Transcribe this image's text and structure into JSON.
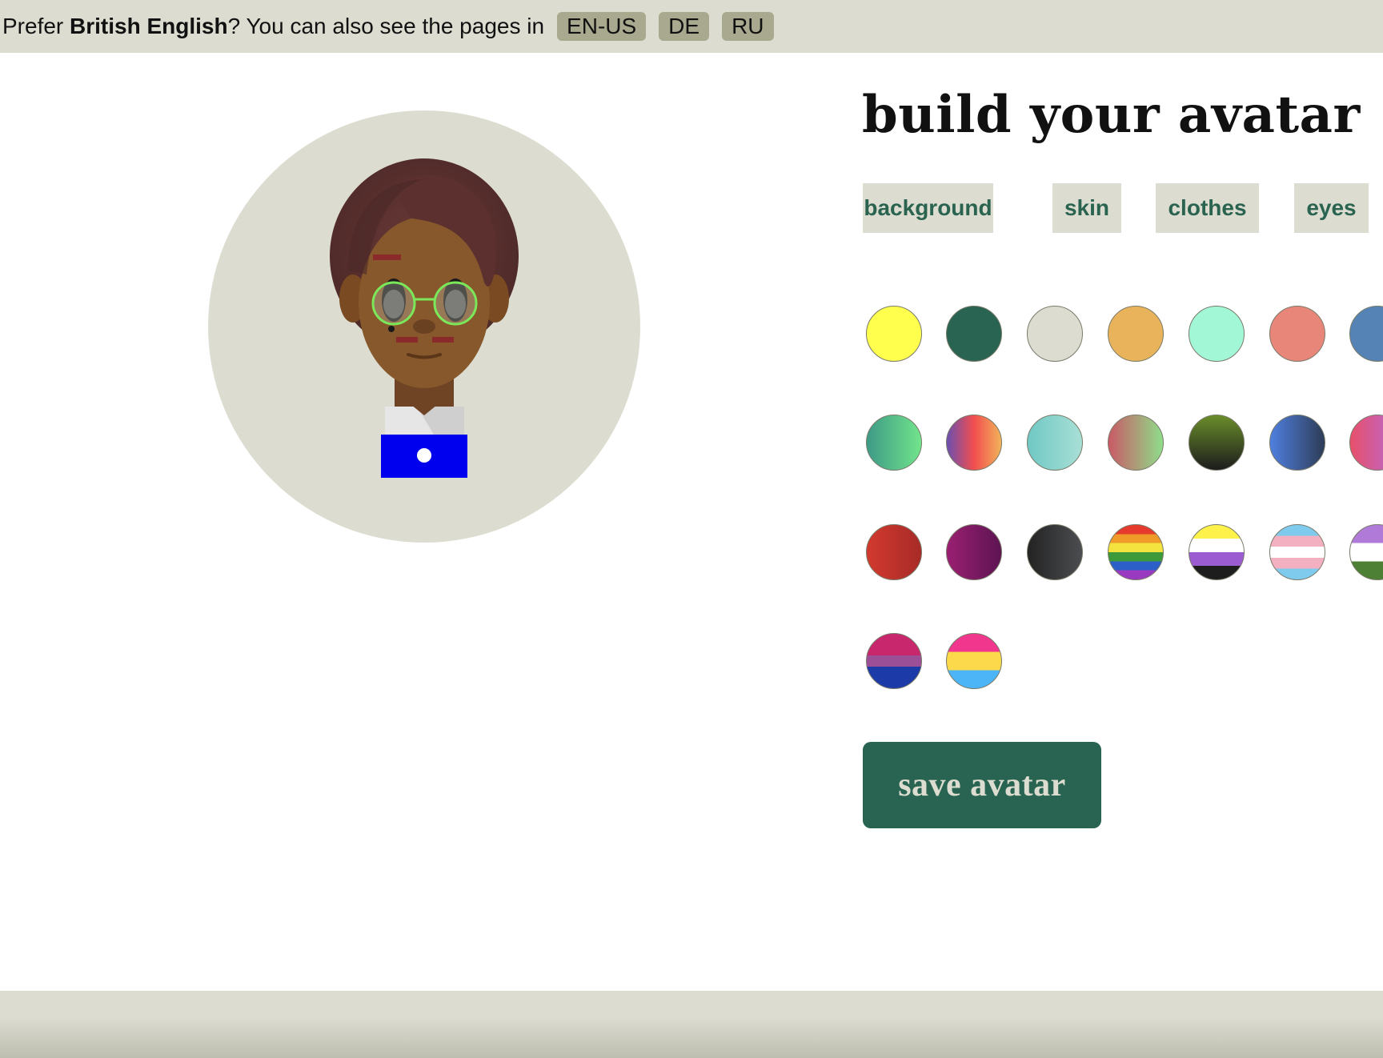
{
  "banner": {
    "prefix": "Prefer ",
    "language_name": "British English",
    "suffix": "? You can also see the pages in",
    "languages": [
      "EN-US",
      "DE",
      "RU"
    ]
  },
  "builder": {
    "title": "build your avatar",
    "tabs": [
      "background",
      "skin",
      "clothes",
      "eyes"
    ],
    "save_label": "save avatar"
  },
  "colors": {
    "banner_bg": "#dcddd0",
    "accent_green": "#296351",
    "tab_text": "#2a6350",
    "avatar_bg": "#dcddd0"
  },
  "background_swatches": [
    {
      "name": "yellow",
      "fill": "#ffff4d"
    },
    {
      "name": "dark-green",
      "fill": "#296351"
    },
    {
      "name": "light-gray",
      "fill": "#dcddd0"
    },
    {
      "name": "orange",
      "fill": "#e8b35a"
    },
    {
      "name": "mint",
      "fill": "#a2f7d6"
    },
    {
      "name": "salmon",
      "fill": "#e8867a"
    },
    {
      "name": "steel-blue",
      "fill": "#5583b5"
    },
    {
      "name": "teal-green-gradient",
      "fill": "linear-gradient(90deg,#3d9a86,#72e48c)"
    },
    {
      "name": "purple-red-orange-gradient",
      "fill": "linear-gradient(90deg,#6a4fb0,#f24e4e,#f2b35a)"
    },
    {
      "name": "aqua-gradient",
      "fill": "linear-gradient(90deg,#70c8c4,#a8dfd6)"
    },
    {
      "name": "red-green-gradient",
      "fill": "linear-gradient(90deg,#c95a66,#8fdd8a)"
    },
    {
      "name": "olive-black-gradient",
      "fill": "linear-gradient(180deg,#6a8d2a,#1c1c1c)"
    },
    {
      "name": "blue-navy-gradient",
      "fill": "linear-gradient(90deg,#4f7fe0,#2e3d57)"
    },
    {
      "name": "pink-purple-gradient",
      "fill": "linear-gradient(90deg,#e8506a,#b36be0)"
    },
    {
      "name": "red-gradient",
      "fill": "linear-gradient(90deg,#d23a2e,#a82a28)"
    },
    {
      "name": "magenta-gradient",
      "fill": "linear-gradient(90deg,#9a1f72,#5d1452)"
    },
    {
      "name": "charcoal-gradient",
      "fill": "linear-gradient(90deg,#232323,#4b4d50)"
    },
    {
      "name": "rainbow-flag",
      "fill": "linear-gradient(180deg,#e53a2c 0%,#e53a2c 16.6%,#f09a2a 16.6%,#f09a2a 33.3%,#f4e23e 33.3%,#f4e23e 50%,#3c9a3a 50%,#3c9a3a 66.6%,#2c5fc8 66.6%,#2c5fc8 83.3%,#9a3ac0 83.3%,#9a3ac0 100%)"
    },
    {
      "name": "nonbinary-flag",
      "fill": "linear-gradient(180deg,#fdf14a 0%,#fdf14a 25%,#ffffff 25%,#ffffff 50%,#9a5cd0 50%,#9a5cd0 75%,#1d1d1d 75%,#1d1d1d 100%)"
    },
    {
      "name": "transgender-flag",
      "fill": "linear-gradient(180deg,#7ecbee 0%,#7ecbee 20%,#f2b0c0 20%,#f2b0c0 40%,#ffffff 40%,#ffffff 60%,#f2b0c0 60%,#f2b0c0 80%,#7ecbee 80%,#7ecbee 100%)"
    },
    {
      "name": "genderqueer-flag",
      "fill": "linear-gradient(180deg,#b07ad8 0%,#b07ad8 33.3%,#ffffff 33.3%,#ffffff 66.6%,#4d8034 66.6%,#4d8034 100%)"
    },
    {
      "name": "bisexual-flag",
      "fill": "linear-gradient(180deg,#c8276e 0%,#c8276e 40%,#9a4f96 40%,#9a4f96 60%,#1c3aa8 60%,#1c3aa8 100%)"
    },
    {
      "name": "pansexual-flag",
      "fill": "linear-gradient(180deg,#f0378d 0%,#f0378d 33.3%,#fbd94a 33.3%,#fbd94a 66.6%,#4bb5f8 66.6%,#4bb5f8 100%)"
    }
  ]
}
